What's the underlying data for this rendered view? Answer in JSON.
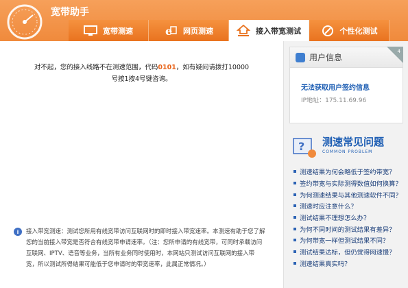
{
  "app": {
    "title": "宽带助手"
  },
  "tabs": [
    {
      "label": "宽带测速",
      "icon": "monitor-icon"
    },
    {
      "label": "网页测速",
      "icon": "browser-icon"
    },
    {
      "label": "接入带宽测试",
      "icon": "home-network-icon",
      "active": true
    },
    {
      "label": "个性化测试",
      "icon": "tools-icon"
    }
  ],
  "main": {
    "message_line1_pre": "对不起，您的接入线路不在测速范围，代码",
    "message_code": "0101",
    "message_line1_post": "，如有疑问请拨打10000",
    "message_line2": "号按1按4号键咨询。",
    "note": "接入带宽测速：测试您所用有线宽带访问互联网时的即时接入带宽速率。本测速有助于您了解您的当前接入带宽是否符合有线宽带申请速率。（注：您所申请的有线宽带，可同时承载访问互联网、IPTV、语音等业务，当所有业务同时使用时，本网站只测试访问互联网的接入带宽，所以测试所得结果可能低于您申请时的带宽速率，此属正常情况。）"
  },
  "sidebar": {
    "user_card": {
      "title": "用户信息",
      "badge": "4",
      "status": "无法获取用户签约信息",
      "ip_label": "IP地址：",
      "ip_value": "175.11.69.96"
    },
    "faq": {
      "title": "测速常见问题",
      "subtitle": "COMMON PROBLEM",
      "items": [
        "测速结果为何会略低于签约带宽？",
        "签约带宽与实际测得数值如何换算？",
        "为何测速结果与其他测速软件不同？",
        "测速时应注意什么？",
        "测试结果不理想怎么办？",
        "为何不同时间的测试结果有差异？",
        "为何带宽一样但测试结果不同？",
        "测试结果达标，但仍觉得网速慢？",
        "测速结果真实吗？"
      ]
    }
  },
  "colors": {
    "brand_orange": "#f08a3c",
    "link_blue": "#1f5fb4",
    "code_orange": "#e8641a"
  }
}
